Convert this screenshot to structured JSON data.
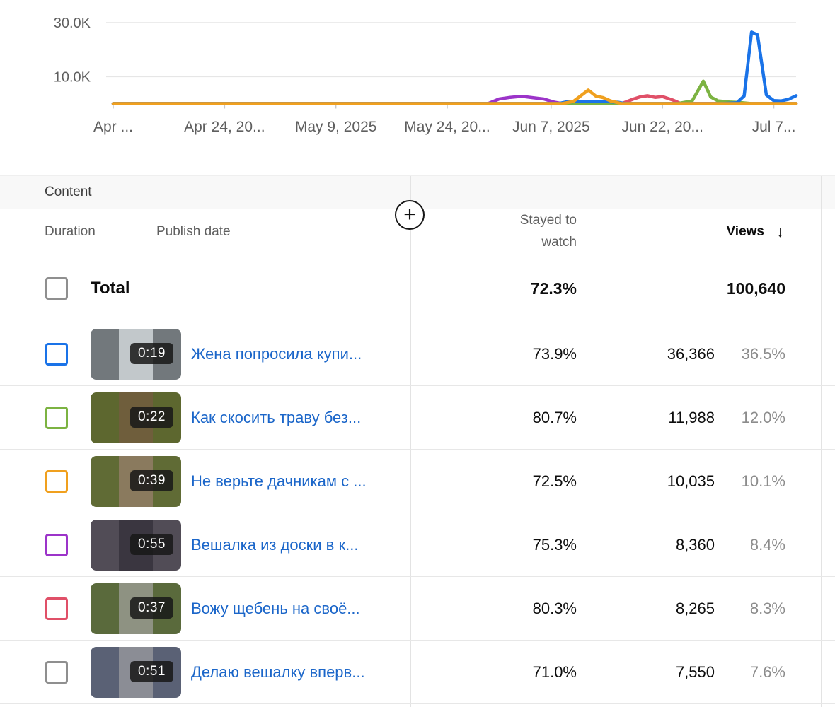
{
  "chart_data": {
    "type": "line",
    "title": "",
    "xlabel": "",
    "ylabel": "",
    "grid": true,
    "legend": "none",
    "ylim": [
      0,
      33000
    ],
    "xlim_days": [
      0,
      92
    ],
    "y_ticks": [
      {
        "label": "10.0K",
        "value": 10000
      },
      {
        "label": "30.0K",
        "value": 30000
      }
    ],
    "x_ticks": [
      {
        "label": "Apr ...",
        "day": 0
      },
      {
        "label": "Apr 24, 20...",
        "day": 15
      },
      {
        "label": "May 9, 2025",
        "day": 30
      },
      {
        "label": "May 24, 20...",
        "day": 45
      },
      {
        "label": "Jun 7, 2025",
        "day": 59
      },
      {
        "label": "Jun 22, 20...",
        "day": 74
      },
      {
        "label": "Jul 7...",
        "day": 89
      }
    ],
    "series": [
      {
        "name": "Вешалка из доски в к...",
        "color": "#9c34c9",
        "points": [
          [
            0,
            0
          ],
          [
            50.5,
            0
          ],
          [
            52,
            1700
          ],
          [
            53.5,
            2300
          ],
          [
            55,
            2700
          ],
          [
            56.5,
            2200
          ],
          [
            58,
            1700
          ],
          [
            59.5,
            500
          ],
          [
            60.5,
            0
          ],
          [
            92,
            0
          ]
        ]
      },
      {
        "name": "Вожу щебень на своё...",
        "color": "#e05068",
        "points": [
          [
            0,
            0
          ],
          [
            68.5,
            0
          ],
          [
            70,
            1600
          ],
          [
            71,
            2500
          ],
          [
            72,
            2900
          ],
          [
            73,
            2300
          ],
          [
            74,
            2600
          ],
          [
            75.5,
            1200
          ],
          [
            76.5,
            0
          ],
          [
            92,
            0
          ]
        ]
      },
      {
        "name": "Как скосить траву без...",
        "color": "#7cb342",
        "points": [
          [
            0,
            0
          ],
          [
            76,
            0
          ],
          [
            78,
            1000
          ],
          [
            79.5,
            8300
          ],
          [
            80.5,
            2400
          ],
          [
            81.5,
            1000
          ],
          [
            83,
            600
          ],
          [
            84.5,
            400
          ],
          [
            86,
            0
          ],
          [
            92,
            0
          ]
        ]
      },
      {
        "name": "Жена попросила купи...",
        "color": "#1a73e8",
        "points": [
          [
            0,
            0
          ],
          [
            60,
            0
          ],
          [
            61,
            600
          ],
          [
            63,
            800
          ],
          [
            66,
            800
          ],
          [
            68,
            500
          ],
          [
            69,
            0
          ],
          [
            82,
            0
          ],
          [
            84,
            300
          ],
          [
            85,
            2800
          ],
          [
            86,
            26500
          ],
          [
            86.8,
            25500
          ],
          [
            88,
            3200
          ],
          [
            89,
            1100
          ],
          [
            90,
            1000
          ],
          [
            91,
            1600
          ],
          [
            92,
            2900
          ]
        ]
      },
      {
        "name": "Не верьте дачникам с ...",
        "color": "#f0a01e",
        "points": [
          [
            0,
            0
          ],
          [
            60.5,
            0
          ],
          [
            62,
            800
          ],
          [
            64,
            5000
          ],
          [
            65,
            2800
          ],
          [
            66,
            2200
          ],
          [
            67,
            1000
          ],
          [
            68.5,
            0
          ],
          [
            92,
            0
          ]
        ]
      }
    ]
  },
  "table": {
    "group_header": "Content",
    "columns": {
      "duration": "Duration",
      "publish_date": "Publish date",
      "stayed": "Stayed to watch",
      "views": "Views"
    },
    "sort_icon": "↓",
    "add_column_button": "+",
    "total": {
      "label": "Total",
      "stayed": "72.3%",
      "views": "100,640"
    },
    "rows": [
      {
        "color": "#1a73e8",
        "duration": "0:19",
        "title": "Жена попросила купи...",
        "stayed": "73.9%",
        "views": "36,366",
        "views_pct": "36.5%",
        "thumb_side": "#72787c",
        "thumb_strip": "#c2c8cb"
      },
      {
        "color": "#7cb342",
        "duration": "0:22",
        "title": "Как скосить траву без...",
        "stayed": "80.7%",
        "views": "11,988",
        "views_pct": "12.0%",
        "thumb_side": "#5d672f",
        "thumb_strip": "#6f5e3c"
      },
      {
        "color": "#f0a01e",
        "duration": "0:39",
        "title": "Не верьте дачникам с ...",
        "stayed": "72.5%",
        "views": "10,035",
        "views_pct": "10.1%",
        "thumb_side": "#606b35",
        "thumb_strip": "#8a7a5e"
      },
      {
        "color": "#9c34c9",
        "duration": "0:55",
        "title": "Вешалка из доски в к...",
        "stayed": "75.3%",
        "views": "8,360",
        "views_pct": "8.4%",
        "thumb_side": "#514c56",
        "thumb_strip": "#3a3640"
      },
      {
        "color": "#e05068",
        "duration": "0:37",
        "title": "Вожу щебень на своё...",
        "stayed": "80.3%",
        "views": "8,265",
        "views_pct": "8.3%",
        "thumb_side": "#5a6a3c",
        "thumb_strip": "#8e9282"
      },
      {
        "color": "#8f8f8f",
        "duration": "0:51",
        "title": "Делаю вешалку вперв...",
        "stayed": "71.0%",
        "views": "7,550",
        "views_pct": "7.6%",
        "thumb_side": "#5a6175",
        "thumb_strip": "#8b8d95"
      }
    ]
  },
  "theme": {
    "link_color": "#1b66c9",
    "grid_color": "#e6e6e6",
    "axis_label_color": "#5f5f5f",
    "muted_text": "#8c8c8c"
  }
}
